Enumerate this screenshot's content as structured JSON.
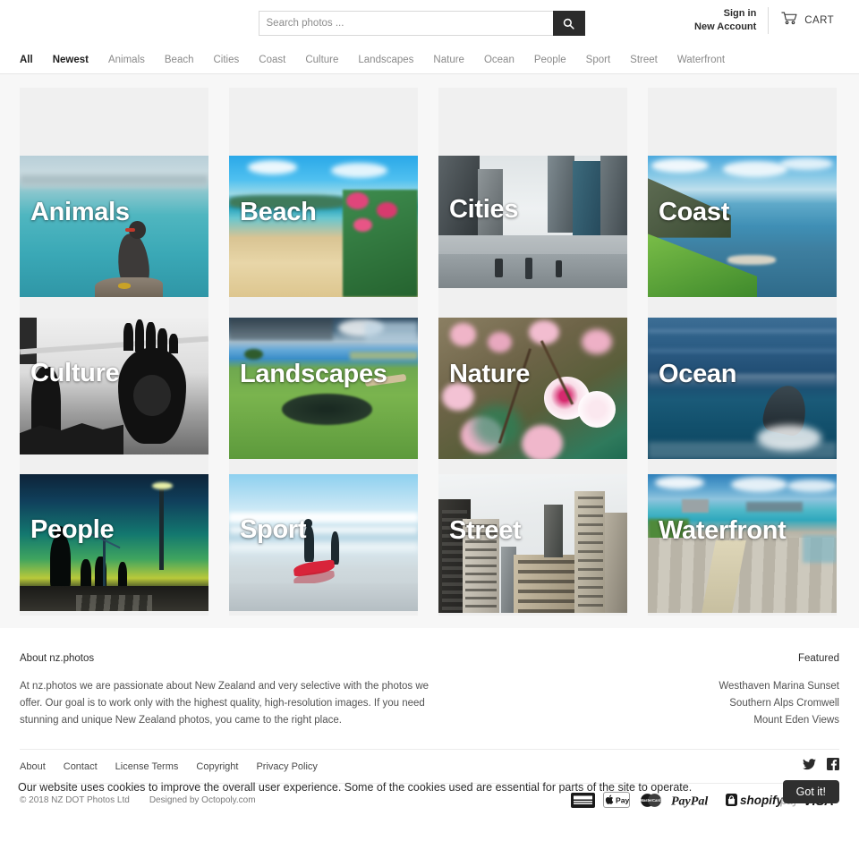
{
  "site": {
    "name": "nz.photos"
  },
  "search": {
    "placeholder": "Search photos ...",
    "value": "",
    "icon": "search-icon"
  },
  "account": {
    "sign_in": "Sign in",
    "new_account": "New Account"
  },
  "cart": {
    "label": "CART",
    "icon": "cart-icon"
  },
  "nav": {
    "items": [
      {
        "label": "All",
        "active": true
      },
      {
        "label": "Newest",
        "active": true
      },
      {
        "label": "Animals",
        "active": false
      },
      {
        "label": "Beach",
        "active": false
      },
      {
        "label": "Cities",
        "active": false
      },
      {
        "label": "Coast",
        "active": false
      },
      {
        "label": "Culture",
        "active": false
      },
      {
        "label": "Landscapes",
        "active": false
      },
      {
        "label": "Nature",
        "active": false
      },
      {
        "label": "Ocean",
        "active": false
      },
      {
        "label": "People",
        "active": false
      },
      {
        "label": "Sport",
        "active": false
      },
      {
        "label": "Street",
        "active": false
      },
      {
        "label": "Waterfront",
        "active": false
      }
    ]
  },
  "grid": {
    "tiles": [
      {
        "label": "Animals",
        "scene": "animals"
      },
      {
        "label": "Beach",
        "scene": "beach"
      },
      {
        "label": "Cities",
        "scene": "cities"
      },
      {
        "label": "Coast",
        "scene": "coast"
      },
      {
        "label": "Culture",
        "scene": "culture"
      },
      {
        "label": "Landscapes",
        "scene": "landscapes"
      },
      {
        "label": "Nature",
        "scene": "nature"
      },
      {
        "label": "Ocean",
        "scene": "ocean"
      },
      {
        "label": "People",
        "scene": "people"
      },
      {
        "label": "Sport",
        "scene": "sport"
      },
      {
        "label": "Street",
        "scene": "street"
      },
      {
        "label": "Waterfront",
        "scene": "waterfront"
      }
    ]
  },
  "footer": {
    "about_title": "About nz.photos",
    "about_text": "At nz.photos we are passionate about New Zealand and very selective with the photos we offer. Our goal is to work only with the highest quality, high-resolution images. If you need stunning and unique New Zealand photos, you came to the right place.",
    "featured_title": "Featured",
    "featured_items": [
      "Westhaven Marina Sunset",
      "Southern Alps Cromwell",
      "Mount Eden Views"
    ],
    "links": [
      "About",
      "Contact",
      "License Terms",
      "Copyright",
      "Privacy Policy"
    ],
    "social": [
      {
        "name": "twitter-icon"
      },
      {
        "name": "facebook-icon"
      }
    ],
    "copyright": "© 2018 NZ DOT Photos Ltd",
    "designed_by": "Designed by Octopoly.com",
    "payments": [
      "American Express",
      "Apple Pay",
      "Mastercard",
      "PayPal",
      "Shopify Pay",
      "VISA"
    ]
  },
  "cookie": {
    "text": "Our website uses cookies to improve the overall user experience. Some of the cookies used are essential for parts of the site to operate.",
    "button": "Got it!"
  }
}
